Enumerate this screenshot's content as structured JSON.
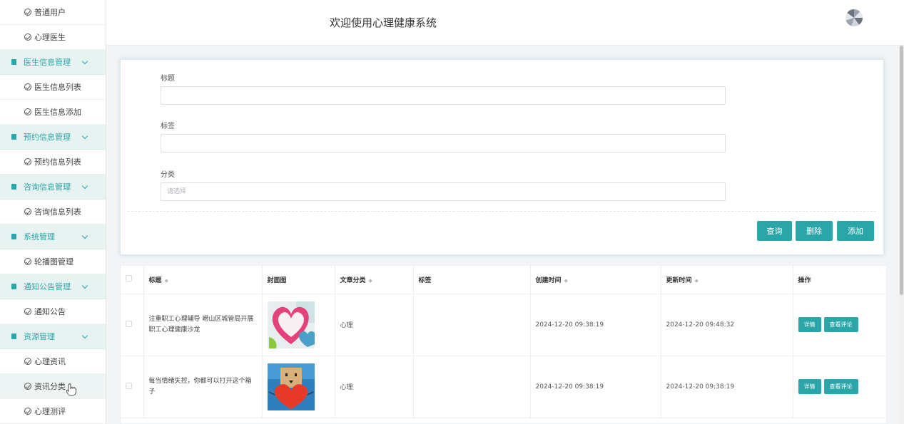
{
  "header": {
    "title": "欢迎使用心理健康系统"
  },
  "sidebar": {
    "items": [
      {
        "type": "sub",
        "label": "普通用户"
      },
      {
        "type": "sub",
        "label": "心理医生"
      },
      {
        "type": "group",
        "label": "医生信息管理"
      },
      {
        "type": "sub",
        "label": "医生信息列表"
      },
      {
        "type": "sub",
        "label": "医生信息添加"
      },
      {
        "type": "group",
        "label": "预约信息管理"
      },
      {
        "type": "sub",
        "label": "预约信息列表"
      },
      {
        "type": "group",
        "label": "咨询信息管理"
      },
      {
        "type": "sub",
        "label": "咨询信息列表"
      },
      {
        "type": "group",
        "label": "系统管理"
      },
      {
        "type": "sub",
        "label": "轮播图管理"
      },
      {
        "type": "group",
        "label": "通知公告管理"
      },
      {
        "type": "sub",
        "label": "通知公告"
      },
      {
        "type": "group",
        "label": "资源管理"
      },
      {
        "type": "sub",
        "label": "心理资讯"
      },
      {
        "type": "sub",
        "label": "资讯分类",
        "hover": true
      },
      {
        "type": "sub",
        "label": "心理测评"
      }
    ]
  },
  "filter": {
    "title_label": "标题",
    "title_value": "",
    "tag_label": "标签",
    "tag_value": "",
    "category_label": "分类",
    "category_placeholder": "请选择",
    "query_button": "查询",
    "delete_button": "删除",
    "add_button": "添加"
  },
  "table": {
    "headers": {
      "title": "标题",
      "cover": "封面图",
      "category": "文章分类",
      "tags": "标签",
      "created": "创建时间",
      "updated": "更新时间",
      "actions": "操作"
    },
    "rows": [
      {
        "title": "注重职工心理辅导 崂山区城管局开展职工心理健康沙龙",
        "category": "心理",
        "tags": "",
        "created": "2024-12-20 09:38:19",
        "updated": "2024-12-20 09:48:32",
        "detail_button": "详情",
        "comments_button": "查看评论"
      },
      {
        "title": "每当情绪失控，你都可以打开这个箱子",
        "category": "心理",
        "tags": "",
        "created": "2024-12-20 09:38:19",
        "updated": "2024-12-20 09:38:19",
        "detail_button": "详情",
        "comments_button": "查看评论"
      }
    ]
  },
  "colors": {
    "accent": "#2aa5a8",
    "group_bg": "#e7f3f1"
  },
  "icons": {
    "sub_item": "check-circle-icon",
    "group": "document-icon",
    "expand": "chevron-down-icon",
    "sort": "sort-icon",
    "cursor": "hand-pointer-cursor"
  }
}
